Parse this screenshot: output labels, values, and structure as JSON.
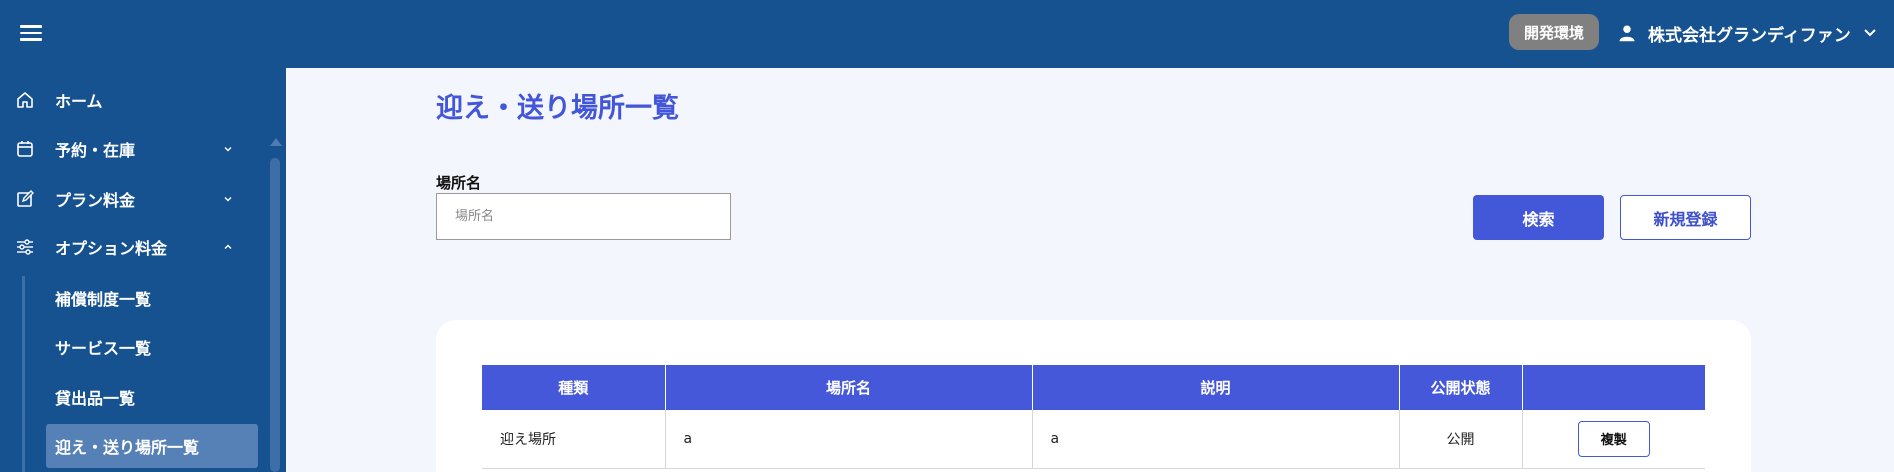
{
  "header": {
    "env_badge": "開発環境",
    "account_name": "株式会社グランディファン",
    "icons": {
      "menu": "hamburger-menu-icon",
      "user": "person-icon",
      "chevron": "chevron-down-icon"
    }
  },
  "sidebar": {
    "items": [
      {
        "label": "ホーム",
        "icon": "home-icon"
      },
      {
        "label": "予約・在庫",
        "icon": "calendar-icon",
        "expand": "chevron-down"
      },
      {
        "label": "プラン料金",
        "icon": "edit-icon",
        "expand": "chevron-down"
      },
      {
        "label": "オプション料金",
        "icon": "sliders-icon",
        "expand": "chevron-up"
      }
    ],
    "sub_items": [
      {
        "label": "補償制度一覧"
      },
      {
        "label": "サービス一覧"
      },
      {
        "label": "貸出品一覧"
      },
      {
        "label": "迎え・送り場所一覧",
        "active": true
      }
    ]
  },
  "main": {
    "title": "迎え・送り場所一覧",
    "filter": {
      "label": "場所名",
      "placeholder": "場所名",
      "value": ""
    },
    "buttons": {
      "search": "検索",
      "new": "新規登録"
    },
    "table": {
      "headers": [
        "種類",
        "場所名",
        "説明",
        "公開状態",
        ""
      ],
      "rows": [
        {
          "type": "迎え場所",
          "name": "a",
          "description": "a",
          "status": "公開",
          "action": "複製"
        }
      ]
    }
  },
  "colors": {
    "header_bg": "#165290",
    "sidebar_bg": "#165290",
    "accent": "#4458d9",
    "page_bg": "#f3f6fd",
    "badge_bg": "#808080",
    "active_nav": "#5581b6"
  }
}
